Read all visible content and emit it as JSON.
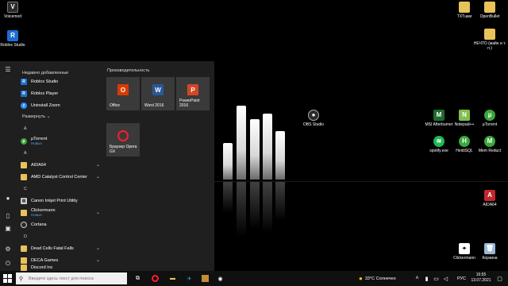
{
  "desktop": {
    "icons_left": [
      {
        "label": "Voicemod",
        "color": "#2b2b2b"
      },
      {
        "label": "Roblox Studio",
        "color": "#1c6fd1"
      }
    ],
    "icons_top_right": [
      {
        "label": "TXTшки",
        "color": "#e8c25a"
      },
      {
        "label": "OpenBullet",
        "color": "#e8c25a"
      },
      {
        "label": "НЕЧТО (майн и т. п.)",
        "color": "#e8c25a"
      }
    ],
    "icons_mid": [
      {
        "label": "OBS Studio",
        "color": "#2b2b2b"
      },
      {
        "label": "MSI Afterburner",
        "color": "#1e6b2e"
      },
      {
        "label": "Notepad++",
        "color": "#7fbf4d"
      },
      {
        "label": "µTorrent",
        "color": "#3aa83a"
      },
      {
        "label": "spotify.exe",
        "color": "#1db954"
      },
      {
        "label": "HeidiSQL",
        "color": "#3aa83a"
      },
      {
        "label": "Mem Reduct",
        "color": "#3aa83a"
      },
      {
        "label": "AIDA64",
        "color": "#c1272d"
      },
      {
        "label": "Clickermann",
        "color": "#ffffff"
      },
      {
        "label": "Корзина",
        "color": "#9ab8d8"
      }
    ]
  },
  "start_menu": {
    "recent_title": "Недавно добавленные",
    "recent": [
      {
        "label": "Roblox Studio",
        "color": "#1c6fd1"
      },
      {
        "label": "Roblox Player",
        "color": "#1c6fd1"
      },
      {
        "label": "Uninstall Zoom",
        "color": "#2d8cff"
      }
    ],
    "expand_label": "Развернуть",
    "letters": [
      "&",
      "A",
      "C",
      "D"
    ],
    "apps": [
      {
        "label": "µTorrent",
        "sub": "Новые",
        "color": "#3aa83a"
      },
      {
        "label": "AIDA64",
        "sub": "",
        "color": "#e8c25a"
      },
      {
        "label": "AMD Catalyst Control Center",
        "sub": "",
        "color": "#e8c25a"
      },
      {
        "label": "Canon Inkjet Print Utility",
        "sub": "",
        "color": "#cfcfcf"
      },
      {
        "label": "Clickermann",
        "sub": "Новые",
        "color": "#e8c25a"
      },
      {
        "label": "Cortana",
        "sub": "",
        "color": "#2b2b2b"
      },
      {
        "label": "Dead Cells Fatal Falls",
        "sub": "",
        "color": "#e8c25a"
      },
      {
        "label": "DECA Games",
        "sub": "",
        "color": "#e8c25a"
      },
      {
        "label": "Discord Inc",
        "sub": "",
        "color": "#e8c25a"
      }
    ],
    "tiles_title": "Производительность",
    "tiles": [
      {
        "label": "Office",
        "color": "#d83b01",
        "glyph": "O"
      },
      {
        "label": "Word 2016",
        "color": "#2b579a",
        "glyph": "W"
      },
      {
        "label": "PowerPoint 2016",
        "color": "#d24726",
        "glyph": "P"
      },
      {
        "label": "Браузер Opera GX",
        "color": "#ff1b2d",
        "glyph": "O"
      }
    ]
  },
  "taskbar": {
    "search_placeholder": "Введите здесь текст для поиска",
    "weather": "33°C  Солнечно",
    "language": "РУС",
    "time": "16:55",
    "date": "13.07.2021"
  },
  "colors": {
    "menu_bg": "#1f1f1f",
    "tile_bg": "#3a3a3a",
    "accent_new": "#4aa3e8",
    "taskbar_bg": "#101010"
  }
}
